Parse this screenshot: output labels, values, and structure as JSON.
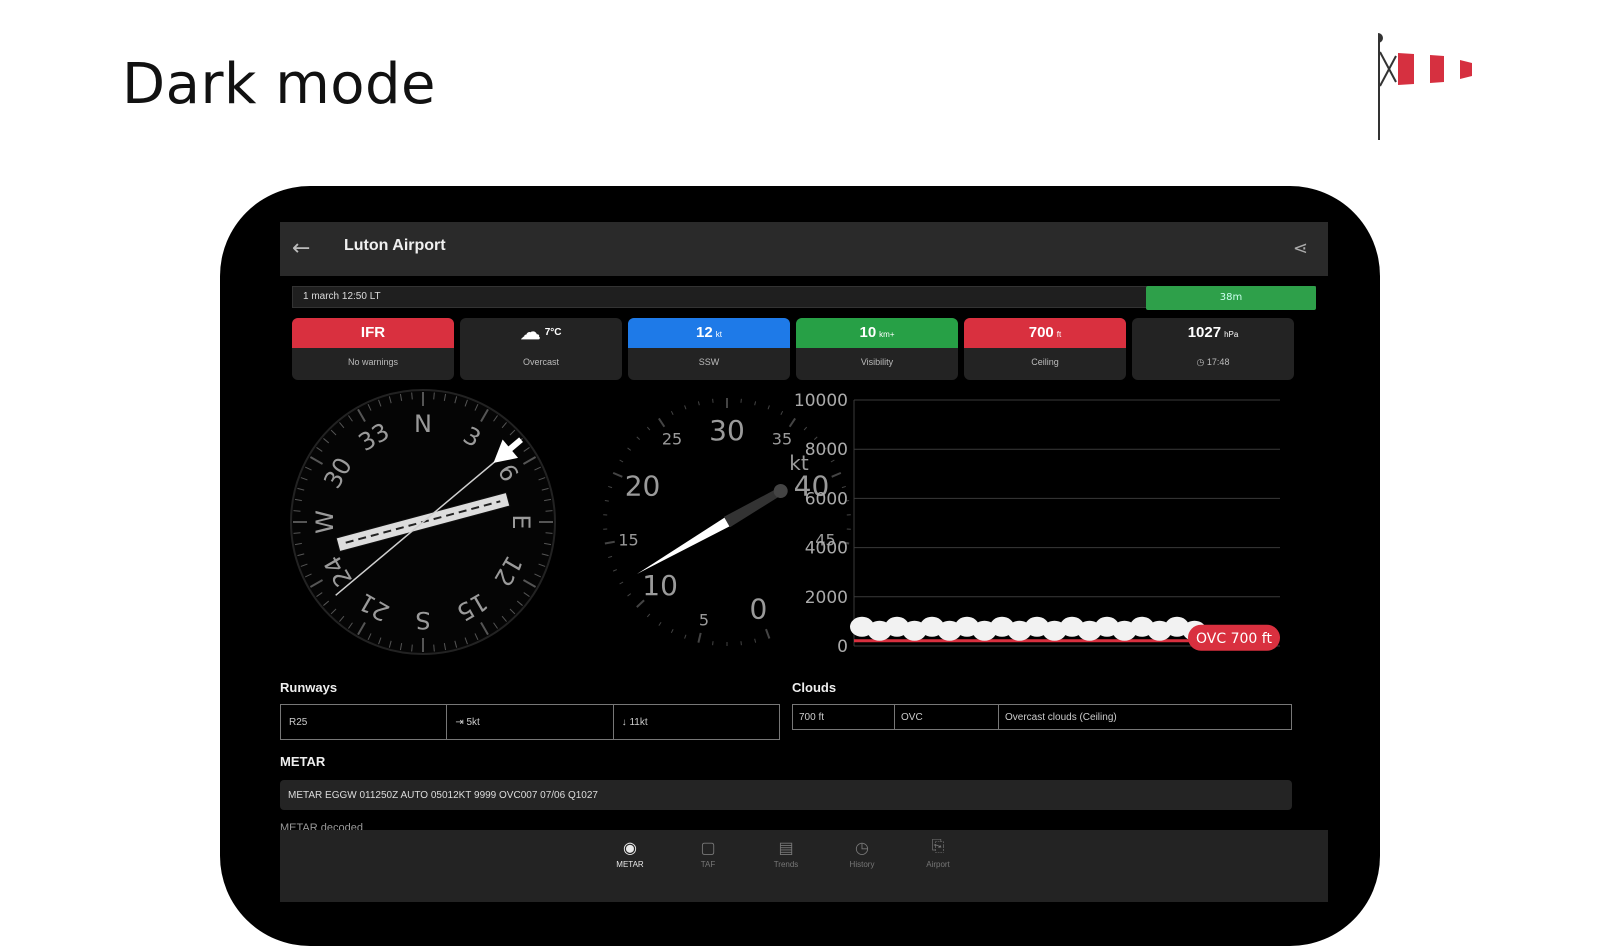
{
  "heading": "Dark mode",
  "icons": {
    "windsock": "windsock-icon",
    "back": "arrow-left-icon",
    "share": "share-icon"
  },
  "colors": {
    "ifr_red": "#d9303f",
    "wind_blue": "#1e7ae8",
    "vis_green": "#27a046",
    "age_green": "#2ea04a"
  },
  "appbar": {
    "title": "Luton Airport"
  },
  "timebar": {
    "timestamp": "1 march 12:50 LT",
    "age": "38m"
  },
  "tiles": [
    {
      "value": "IFR",
      "unit": "",
      "label": "No warnings",
      "icon": ""
    },
    {
      "value": "7°C",
      "unit": "",
      "label": "Overcast",
      "icon": "cloud-icon"
    },
    {
      "value": "12",
      "unit": "kt",
      "label": "SSW",
      "icon": ""
    },
    {
      "value": "10",
      "unit": "km+",
      "label": "Visibility",
      "icon": ""
    },
    {
      "value": "700",
      "unit": "ft",
      "label": "Ceiling",
      "icon": ""
    },
    {
      "value": "1027",
      "unit": "hPa",
      "label": "17:48",
      "icon": "clock-icon"
    }
  ],
  "compass": {
    "cardinals": [
      "N",
      "E",
      "S",
      "W"
    ],
    "ticks": [
      "3",
      "6",
      "12",
      "15",
      "21",
      "24",
      "30",
      "33"
    ],
    "runway_heading_deg": 75,
    "wind_from_deg": 50
  },
  "speed_gauge": {
    "labels": [
      "0",
      "5",
      "10",
      "15",
      "20",
      "25",
      "30",
      "35",
      "40",
      "45"
    ],
    "unit": "kt",
    "value_kt": 12
  },
  "cloud_chart": {
    "y_ticks": [
      "10000",
      "8000",
      "6000",
      "4000",
      "2000",
      "0"
    ],
    "layer_label": "OVC 700 ft",
    "layer_ft": 700
  },
  "runways": {
    "title": "Runways",
    "cells": [
      "R25",
      "5kt",
      "11kt"
    ]
  },
  "clouds": {
    "title": "Clouds",
    "cells": [
      "700 ft",
      "OVC",
      "Overcast clouds (Ceiling)"
    ]
  },
  "metar": {
    "title": "METAR",
    "text": "METAR EGGW 011250Z AUTO 05012KT 9999 OVC007 07/06 Q1027",
    "next_cut": "METAR decoded"
  },
  "nav": [
    {
      "icon": "gauge-icon",
      "label": "METAR"
    },
    {
      "icon": "taf-icon",
      "label": "TAF"
    },
    {
      "icon": "trends-icon",
      "label": "Trends"
    },
    {
      "icon": "history-icon",
      "label": "History"
    },
    {
      "icon": "airport-icon",
      "label": "Airport"
    }
  ]
}
